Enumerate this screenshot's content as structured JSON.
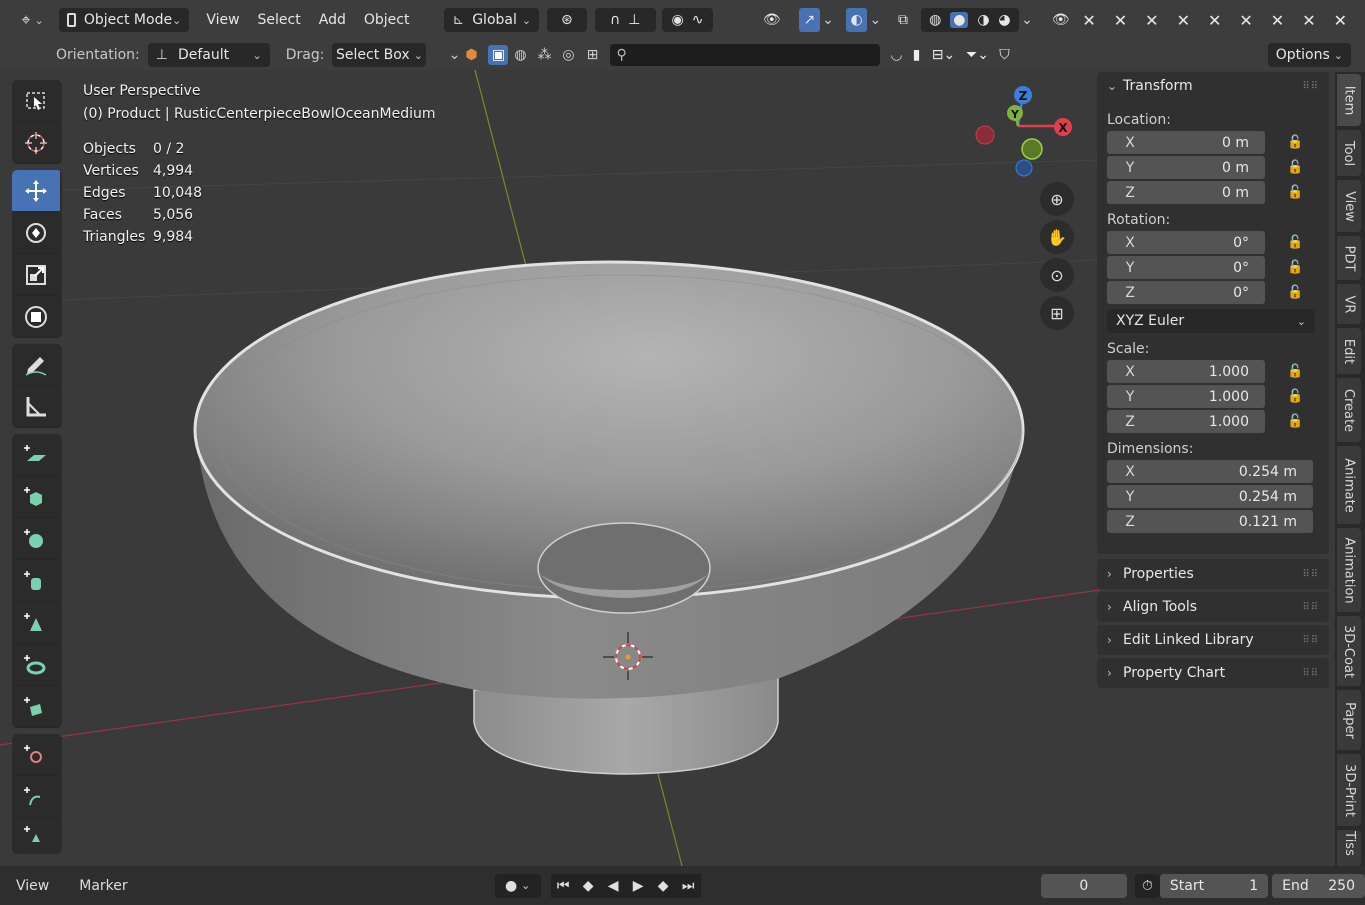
{
  "header": {
    "editor_type_icon": "axis-gizmo-icon",
    "mode": "Object Mode",
    "menus": [
      "View",
      "Select",
      "Add",
      "Object"
    ],
    "transform_orientation": "Global"
  },
  "toolsettings": {
    "orientation_label": "Orientation:",
    "orientation_value": "Default",
    "drag_label": "Drag:",
    "drag_value": "Select Box",
    "search_placeholder": "",
    "options_label": "Options"
  },
  "overlay": {
    "view_name": "User Perspective",
    "object_info": "(0) Product | RusticCenterpieceBowlOceanMedium",
    "stats": [
      {
        "key": "Objects",
        "value": "0 / 2"
      },
      {
        "key": "Vertices",
        "value": "4,994"
      },
      {
        "key": "Edges",
        "value": "10,048"
      },
      {
        "key": "Faces",
        "value": "5,056"
      },
      {
        "key": "Triangles",
        "value": "9,984"
      }
    ]
  },
  "gizmo": {
    "x": "X",
    "y": "Y",
    "z": "Z"
  },
  "sidebar": {
    "transform_title": "Transform",
    "location_label": "Location:",
    "location": [
      {
        "axis": "X",
        "value": "0 m"
      },
      {
        "axis": "Y",
        "value": "0 m"
      },
      {
        "axis": "Z",
        "value": "0 m"
      }
    ],
    "rotation_label": "Rotation:",
    "rotation": [
      {
        "axis": "X",
        "value": "0°"
      },
      {
        "axis": "Y",
        "value": "0°"
      },
      {
        "axis": "Z",
        "value": "0°"
      }
    ],
    "rotation_mode": "XYZ Euler",
    "scale_label": "Scale:",
    "scale": [
      {
        "axis": "X",
        "value": "1.000"
      },
      {
        "axis": "Y",
        "value": "1.000"
      },
      {
        "axis": "Z",
        "value": "1.000"
      }
    ],
    "dimensions_label": "Dimensions:",
    "dimensions": [
      {
        "axis": "X",
        "value": "0.254 m"
      },
      {
        "axis": "Y",
        "value": "0.254 m"
      },
      {
        "axis": "Z",
        "value": "0.121 m"
      }
    ],
    "collapsed_panels": [
      "Properties",
      "Align Tools",
      "Edit Linked Library",
      "Property Chart"
    ]
  },
  "tabs": [
    "Item",
    "Tool",
    "View",
    "PDT",
    "VR",
    "Edit",
    "Create",
    "Animate",
    "Animation",
    "3D-Coat",
    "Paper",
    "3D-Print",
    "Tiss"
  ],
  "timeline": {
    "menus": [
      "View",
      "Marker"
    ],
    "current_frame": "0",
    "start_label": "Start",
    "start_value": "1",
    "end_label": "End",
    "end_value": "250"
  },
  "colors": {
    "accent": "#4772b3",
    "axis_x": "#e0404e",
    "axis_y": "#7fb33a",
    "axis_z": "#3b7fd8"
  }
}
